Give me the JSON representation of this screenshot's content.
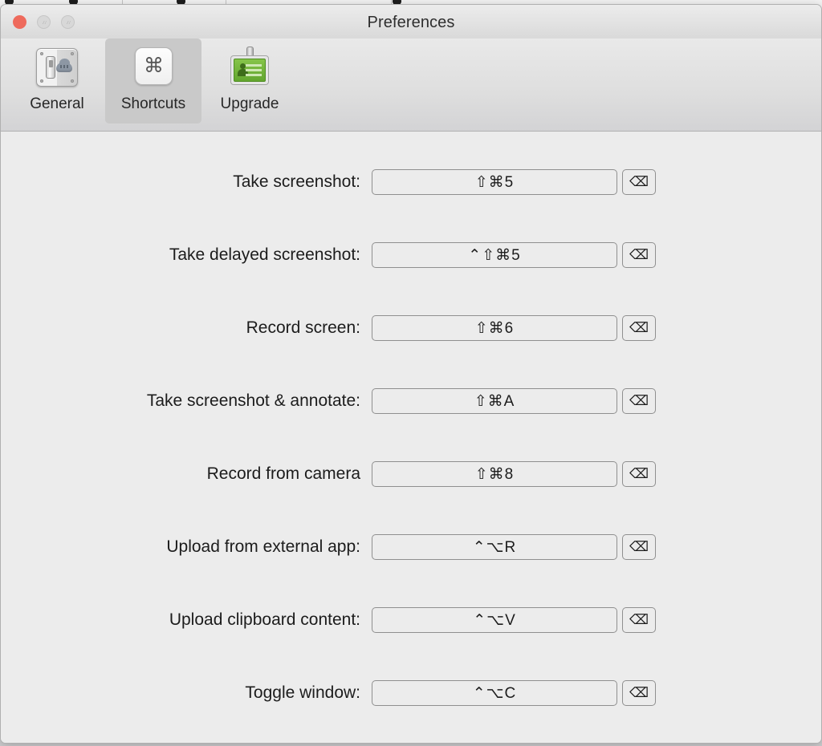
{
  "window": {
    "title": "Preferences",
    "traffic_lights": [
      {
        "name": "close",
        "color": "#ee6a5c",
        "enabled": true
      },
      {
        "name": "minimize",
        "color": "#d8d8d8",
        "enabled": false
      },
      {
        "name": "maximize",
        "color": "#d8d8d8",
        "enabled": false
      }
    ]
  },
  "toolbar": {
    "tabs": [
      {
        "label": "General",
        "icon": "usb-cloud-icon",
        "selected": false
      },
      {
        "label": "Shortcuts",
        "icon": "command-key-icon",
        "selected": true
      },
      {
        "label": "Upgrade",
        "icon": "id-badge-icon",
        "selected": false
      }
    ]
  },
  "shortcuts": {
    "clear_button_glyph": "⌫",
    "rows": [
      {
        "label": "Take screenshot:",
        "shortcut": "⇧⌘5"
      },
      {
        "label": "Take delayed screenshot:",
        "shortcut": "⌃⇧⌘5"
      },
      {
        "label": "Record screen:",
        "shortcut": "⇧⌘6"
      },
      {
        "label": "Take screenshot & annotate:",
        "shortcut": "⇧⌘A"
      },
      {
        "label": "Record from camera",
        "shortcut": "⇧⌘8"
      },
      {
        "label": "Upload from external app:",
        "shortcut": "⌃⌥R"
      },
      {
        "label": "Upload clipboard content:",
        "shortcut": "⌃⌥V"
      },
      {
        "label": "Toggle window:",
        "shortcut": "⌃⌥C"
      }
    ]
  }
}
